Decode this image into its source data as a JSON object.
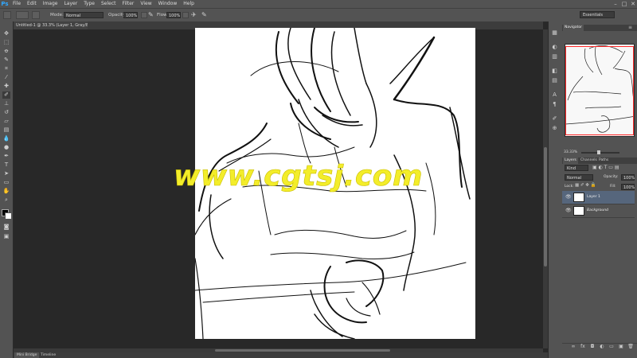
{
  "app": {
    "logo": "Ps"
  },
  "menu": [
    "File",
    "Edit",
    "Image",
    "Layer",
    "Type",
    "Select",
    "Filter",
    "View",
    "Window",
    "Help"
  ],
  "window_controls": {
    "minimize": "–",
    "maximize": "□",
    "close": "✕"
  },
  "options": {
    "mode_label": "Mode:",
    "mode_value": "Normal",
    "opacity_label": "Opacity:",
    "opacity_value": "100%",
    "flow_label": "Flow:",
    "flow_value": "100%",
    "workspace": "Essentials"
  },
  "document": {
    "tab_title": "Untitled-1 @ 33.3% (Layer 1, Gray/8) *"
  },
  "watermark": "www.cgtsj.com",
  "bottom_tabs": [
    "Mini Bridge",
    "Timeline"
  ],
  "navigator": {
    "tab": "Navigator",
    "zoom": "33.33%"
  },
  "layers_panel": {
    "tabs": [
      "Layers",
      "Channels",
      "Paths"
    ],
    "filter": "Kind",
    "blend_mode": "Normal",
    "opacity_label": "Opacity:",
    "opacity_value": "100%",
    "lock_label": "Lock:",
    "fill_label": "Fill:",
    "fill_value": "100%",
    "layers": [
      {
        "name": "Layer 1",
        "selected": true
      },
      {
        "name": "Background",
        "selected": false
      }
    ]
  },
  "icons": {
    "tools": [
      "move-icon",
      "marquee-icon",
      "lasso-icon",
      "quick-select-icon",
      "crop-icon",
      "eyedropper-icon",
      "healing-icon",
      "brush-icon",
      "stamp-icon",
      "history-brush-icon",
      "eraser-icon",
      "gradient-icon",
      "blur-icon",
      "dodge-icon",
      "pen-icon",
      "type-icon",
      "path-select-icon",
      "shape-icon",
      "hand-icon",
      "zoom-icon"
    ]
  },
  "colors": {
    "accent": "#31a8ff",
    "watermark": "#f3ed2a",
    "selection": "#56667c",
    "nav_frame": "#ff2a2a"
  }
}
